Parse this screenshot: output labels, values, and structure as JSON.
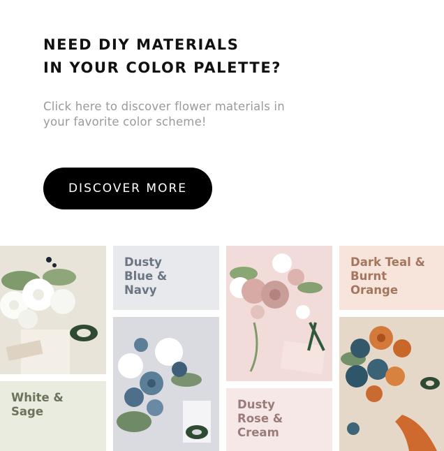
{
  "hero": {
    "headline_line1": "NEED DIY MATERIALS",
    "headline_line2": "IN YOUR COLOR PALETTE?",
    "subtext_line1": "Click here to discover flower materials in",
    "subtext_line2": "your favorite color scheme!",
    "cta_label": "DISCOVER MORE"
  },
  "palettes": [
    {
      "lines": [
        "White &",
        "Sage"
      ],
      "bg": "#e9ecdf",
      "text_color": "#6b735b"
    },
    {
      "lines": [
        "Dusty",
        "Blue &",
        "Navy"
      ],
      "bg": "#e7e9ec",
      "text_color": "#6c7584"
    },
    {
      "lines": [
        "Dusty",
        "Rose &",
        "Cream"
      ],
      "bg": "#f6e8e6",
      "text_color": "#9b7c7a"
    },
    {
      "lines": [
        "Dark Teal &",
        "Burnt Orange"
      ],
      "bg": "#f7e5db",
      "text_color": "#a5765f"
    }
  ]
}
